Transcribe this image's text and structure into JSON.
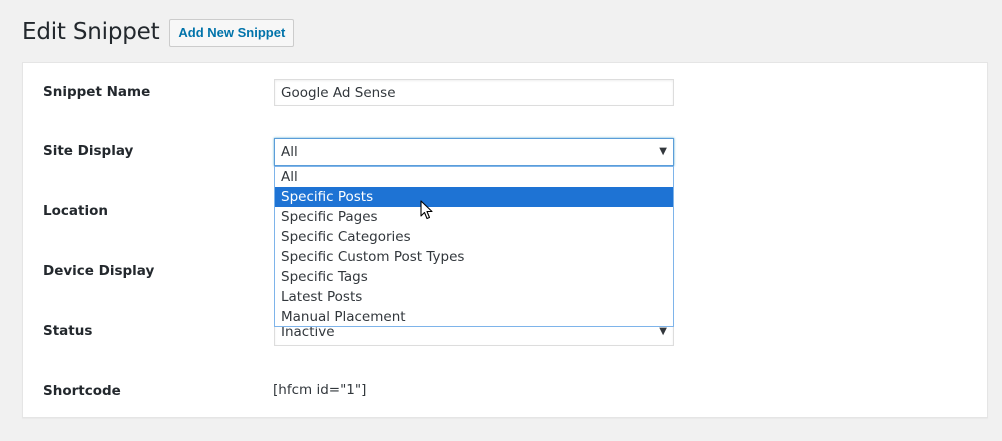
{
  "header": {
    "title": "Edit Snippet",
    "add_new_label": "Add New Snippet"
  },
  "form": {
    "snippet_name": {
      "label": "Snippet Name",
      "value": "Google Ad Sense"
    },
    "site_display": {
      "label": "Site Display",
      "selected": "All",
      "options": [
        "All",
        "Specific Posts",
        "Specific Pages",
        "Specific Categories",
        "Specific Custom Post Types",
        "Specific Tags",
        "Latest Posts",
        "Manual Placement"
      ],
      "highlighted_option": "Specific Posts"
    },
    "location": {
      "label": "Location"
    },
    "device_display": {
      "label": "Device Display"
    },
    "status": {
      "label": "Status",
      "selected": "Inactive"
    },
    "shortcode": {
      "label": "Shortcode",
      "value": "[hfcm id=\"1\"]"
    }
  },
  "icons": {
    "caret": "▼",
    "cursor": "mouse-pointer-icon"
  },
  "colors": {
    "accent": "#0073aa",
    "highlight": "#1e73d4"
  }
}
